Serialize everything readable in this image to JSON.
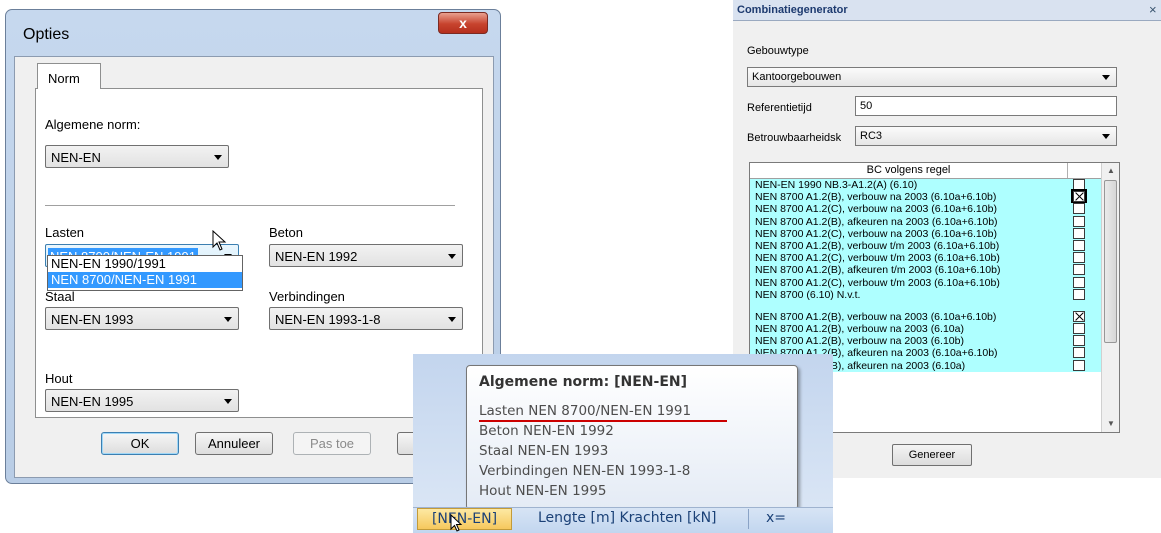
{
  "opties": {
    "title": "Opties",
    "close_label": "x",
    "tab": "Norm",
    "algemene_label": "Algemene norm:",
    "algemene_value": "NEN-EN",
    "lasten_label": "Lasten",
    "lasten_value": "NEN 8700/NEN-EN 1991",
    "lasten_options": [
      "NEN-EN 1990/1991",
      "NEN 8700/NEN-EN 1991"
    ],
    "beton_label": "Beton",
    "beton_value": "NEN-EN 1992",
    "staal_label": "Staal",
    "staal_value": "NEN-EN 1993",
    "verbindingen_label": "Verbindingen",
    "verbindingen_value": "NEN-EN 1993-1-8",
    "hout_label": "Hout",
    "hout_value": "NEN-EN 1995",
    "ok_label": "OK",
    "annuleer_label": "Annuleer",
    "pastoe_label": "Pas toe"
  },
  "combi": {
    "title": "Combinatiegenerator",
    "close_label": "×",
    "gebouwtype_label": "Gebouwtype",
    "gebouwtype_value": "Kantoorgebouwen",
    "referentietijd_label": "Referentietijd",
    "referentietijd_value": "50",
    "betrouwbaarheid_label": "Betrouwbaarheidsk",
    "betrouwbaarheid_value": "RC3",
    "grid_header": "BC volgens regel",
    "rows": [
      {
        "text": "NEN-EN 1990 NB.3-A1.2(A) (6.10)",
        "checked": false
      },
      {
        "text": "NEN 8700 A1.2(B), verbouw na 2003 (6.10a+6.10b)",
        "checked": true
      },
      {
        "text": "NEN 8700 A1.2(C), verbouw na 2003 (6.10a+6.10b)",
        "checked": false
      },
      {
        "text": "NEN 8700 A1.2(B), afkeuren na 2003 (6.10a+6.10b)",
        "checked": false
      },
      {
        "text": "NEN 8700 A1.2(C), verbouw na 2003 (6.10a+6.10b)",
        "checked": false
      },
      {
        "text": "NEN 8700 A1.2(B), verbouw t/m 2003 (6.10a+6.10b)",
        "checked": false
      },
      {
        "text": "NEN 8700 A1.2(C), verbouw t/m 2003 (6.10a+6.10b)",
        "checked": false
      },
      {
        "text": "NEN 8700 A1.2(B), afkeuren t/m 2003 (6.10a+6.10b)",
        "checked": false
      },
      {
        "text": "NEN 8700 A1.2(C), verbouw t/m 2003 (6.10a+6.10b)",
        "checked": false
      },
      {
        "text": "NEN 8700 (6.10) N.v.t.",
        "checked": false
      },
      {
        "text": "",
        "checked": null
      },
      {
        "text": "NEN 8700 A1.2(B), verbouw na 2003 (6.10a+6.10b)",
        "checked": true
      },
      {
        "text": "NEN 8700 A1.2(B), verbouw na 2003 (6.10a)",
        "checked": false
      },
      {
        "text": "NEN 8700 A1.2(B), verbouw na 2003 (6.10b)",
        "checked": false
      },
      {
        "text": "NEN 8700 A1.2(B), afkeuren na 2003 (6.10a+6.10b)",
        "checked": false
      },
      {
        "text": "NEN 8700 A1.2(B), afkeuren na 2003 (6.10a)",
        "checked": false
      }
    ],
    "genereer_label": "Genereer"
  },
  "tooltip": {
    "heading": "Algemene norm: [NEN-EN]",
    "lines": [
      "Lasten NEN 8700/NEN-EN 1991",
      "Beton NEN-EN 1992",
      "Staal NEN-EN 1993",
      "Verbindingen NEN-EN 1993-1-8",
      "Hout NEN-EN 1995"
    ]
  },
  "statusbar": {
    "norm": "[NEN-EN]",
    "units": "Lengte [m] Krachten [kN]",
    "x": "x="
  }
}
